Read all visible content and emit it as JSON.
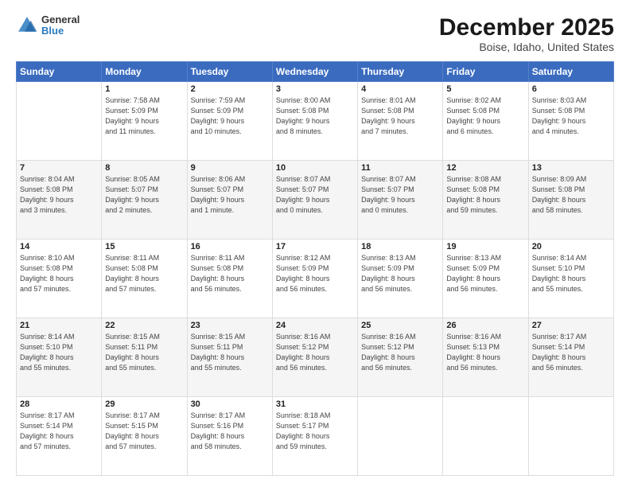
{
  "header": {
    "logo_line1": "General",
    "logo_line2": "Blue",
    "title": "December 2025",
    "subtitle": "Boise, Idaho, United States"
  },
  "calendar": {
    "days_of_week": [
      "Sunday",
      "Monday",
      "Tuesday",
      "Wednesday",
      "Thursday",
      "Friday",
      "Saturday"
    ],
    "weeks": [
      [
        {
          "day": "",
          "info": ""
        },
        {
          "day": "1",
          "info": "Sunrise: 7:58 AM\nSunset: 5:09 PM\nDaylight: 9 hours\nand 11 minutes."
        },
        {
          "day": "2",
          "info": "Sunrise: 7:59 AM\nSunset: 5:09 PM\nDaylight: 9 hours\nand 10 minutes."
        },
        {
          "day": "3",
          "info": "Sunrise: 8:00 AM\nSunset: 5:08 PM\nDaylight: 9 hours\nand 8 minutes."
        },
        {
          "day": "4",
          "info": "Sunrise: 8:01 AM\nSunset: 5:08 PM\nDaylight: 9 hours\nand 7 minutes."
        },
        {
          "day": "5",
          "info": "Sunrise: 8:02 AM\nSunset: 5:08 PM\nDaylight: 9 hours\nand 6 minutes."
        },
        {
          "day": "6",
          "info": "Sunrise: 8:03 AM\nSunset: 5:08 PM\nDaylight: 9 hours\nand 4 minutes."
        }
      ],
      [
        {
          "day": "7",
          "info": "Sunrise: 8:04 AM\nSunset: 5:08 PM\nDaylight: 9 hours\nand 3 minutes."
        },
        {
          "day": "8",
          "info": "Sunrise: 8:05 AM\nSunset: 5:07 PM\nDaylight: 9 hours\nand 2 minutes."
        },
        {
          "day": "9",
          "info": "Sunrise: 8:06 AM\nSunset: 5:07 PM\nDaylight: 9 hours\nand 1 minute."
        },
        {
          "day": "10",
          "info": "Sunrise: 8:07 AM\nSunset: 5:07 PM\nDaylight: 9 hours\nand 0 minutes."
        },
        {
          "day": "11",
          "info": "Sunrise: 8:07 AM\nSunset: 5:07 PM\nDaylight: 9 hours\nand 0 minutes."
        },
        {
          "day": "12",
          "info": "Sunrise: 8:08 AM\nSunset: 5:08 PM\nDaylight: 8 hours\nand 59 minutes."
        },
        {
          "day": "13",
          "info": "Sunrise: 8:09 AM\nSunset: 5:08 PM\nDaylight: 8 hours\nand 58 minutes."
        }
      ],
      [
        {
          "day": "14",
          "info": "Sunrise: 8:10 AM\nSunset: 5:08 PM\nDaylight: 8 hours\nand 57 minutes."
        },
        {
          "day": "15",
          "info": "Sunrise: 8:11 AM\nSunset: 5:08 PM\nDaylight: 8 hours\nand 57 minutes."
        },
        {
          "day": "16",
          "info": "Sunrise: 8:11 AM\nSunset: 5:08 PM\nDaylight: 8 hours\nand 56 minutes."
        },
        {
          "day": "17",
          "info": "Sunrise: 8:12 AM\nSunset: 5:09 PM\nDaylight: 8 hours\nand 56 minutes."
        },
        {
          "day": "18",
          "info": "Sunrise: 8:13 AM\nSunset: 5:09 PM\nDaylight: 8 hours\nand 56 minutes."
        },
        {
          "day": "19",
          "info": "Sunrise: 8:13 AM\nSunset: 5:09 PM\nDaylight: 8 hours\nand 56 minutes."
        },
        {
          "day": "20",
          "info": "Sunrise: 8:14 AM\nSunset: 5:10 PM\nDaylight: 8 hours\nand 55 minutes."
        }
      ],
      [
        {
          "day": "21",
          "info": "Sunrise: 8:14 AM\nSunset: 5:10 PM\nDaylight: 8 hours\nand 55 minutes."
        },
        {
          "day": "22",
          "info": "Sunrise: 8:15 AM\nSunset: 5:11 PM\nDaylight: 8 hours\nand 55 minutes."
        },
        {
          "day": "23",
          "info": "Sunrise: 8:15 AM\nSunset: 5:11 PM\nDaylight: 8 hours\nand 55 minutes."
        },
        {
          "day": "24",
          "info": "Sunrise: 8:16 AM\nSunset: 5:12 PM\nDaylight: 8 hours\nand 56 minutes."
        },
        {
          "day": "25",
          "info": "Sunrise: 8:16 AM\nSunset: 5:12 PM\nDaylight: 8 hours\nand 56 minutes."
        },
        {
          "day": "26",
          "info": "Sunrise: 8:16 AM\nSunset: 5:13 PM\nDaylight: 8 hours\nand 56 minutes."
        },
        {
          "day": "27",
          "info": "Sunrise: 8:17 AM\nSunset: 5:14 PM\nDaylight: 8 hours\nand 56 minutes."
        }
      ],
      [
        {
          "day": "28",
          "info": "Sunrise: 8:17 AM\nSunset: 5:14 PM\nDaylight: 8 hours\nand 57 minutes."
        },
        {
          "day": "29",
          "info": "Sunrise: 8:17 AM\nSunset: 5:15 PM\nDaylight: 8 hours\nand 57 minutes."
        },
        {
          "day": "30",
          "info": "Sunrise: 8:17 AM\nSunset: 5:16 PM\nDaylight: 8 hours\nand 58 minutes."
        },
        {
          "day": "31",
          "info": "Sunrise: 8:18 AM\nSunset: 5:17 PM\nDaylight: 8 hours\nand 59 minutes."
        },
        {
          "day": "",
          "info": ""
        },
        {
          "day": "",
          "info": ""
        },
        {
          "day": "",
          "info": ""
        }
      ]
    ]
  }
}
